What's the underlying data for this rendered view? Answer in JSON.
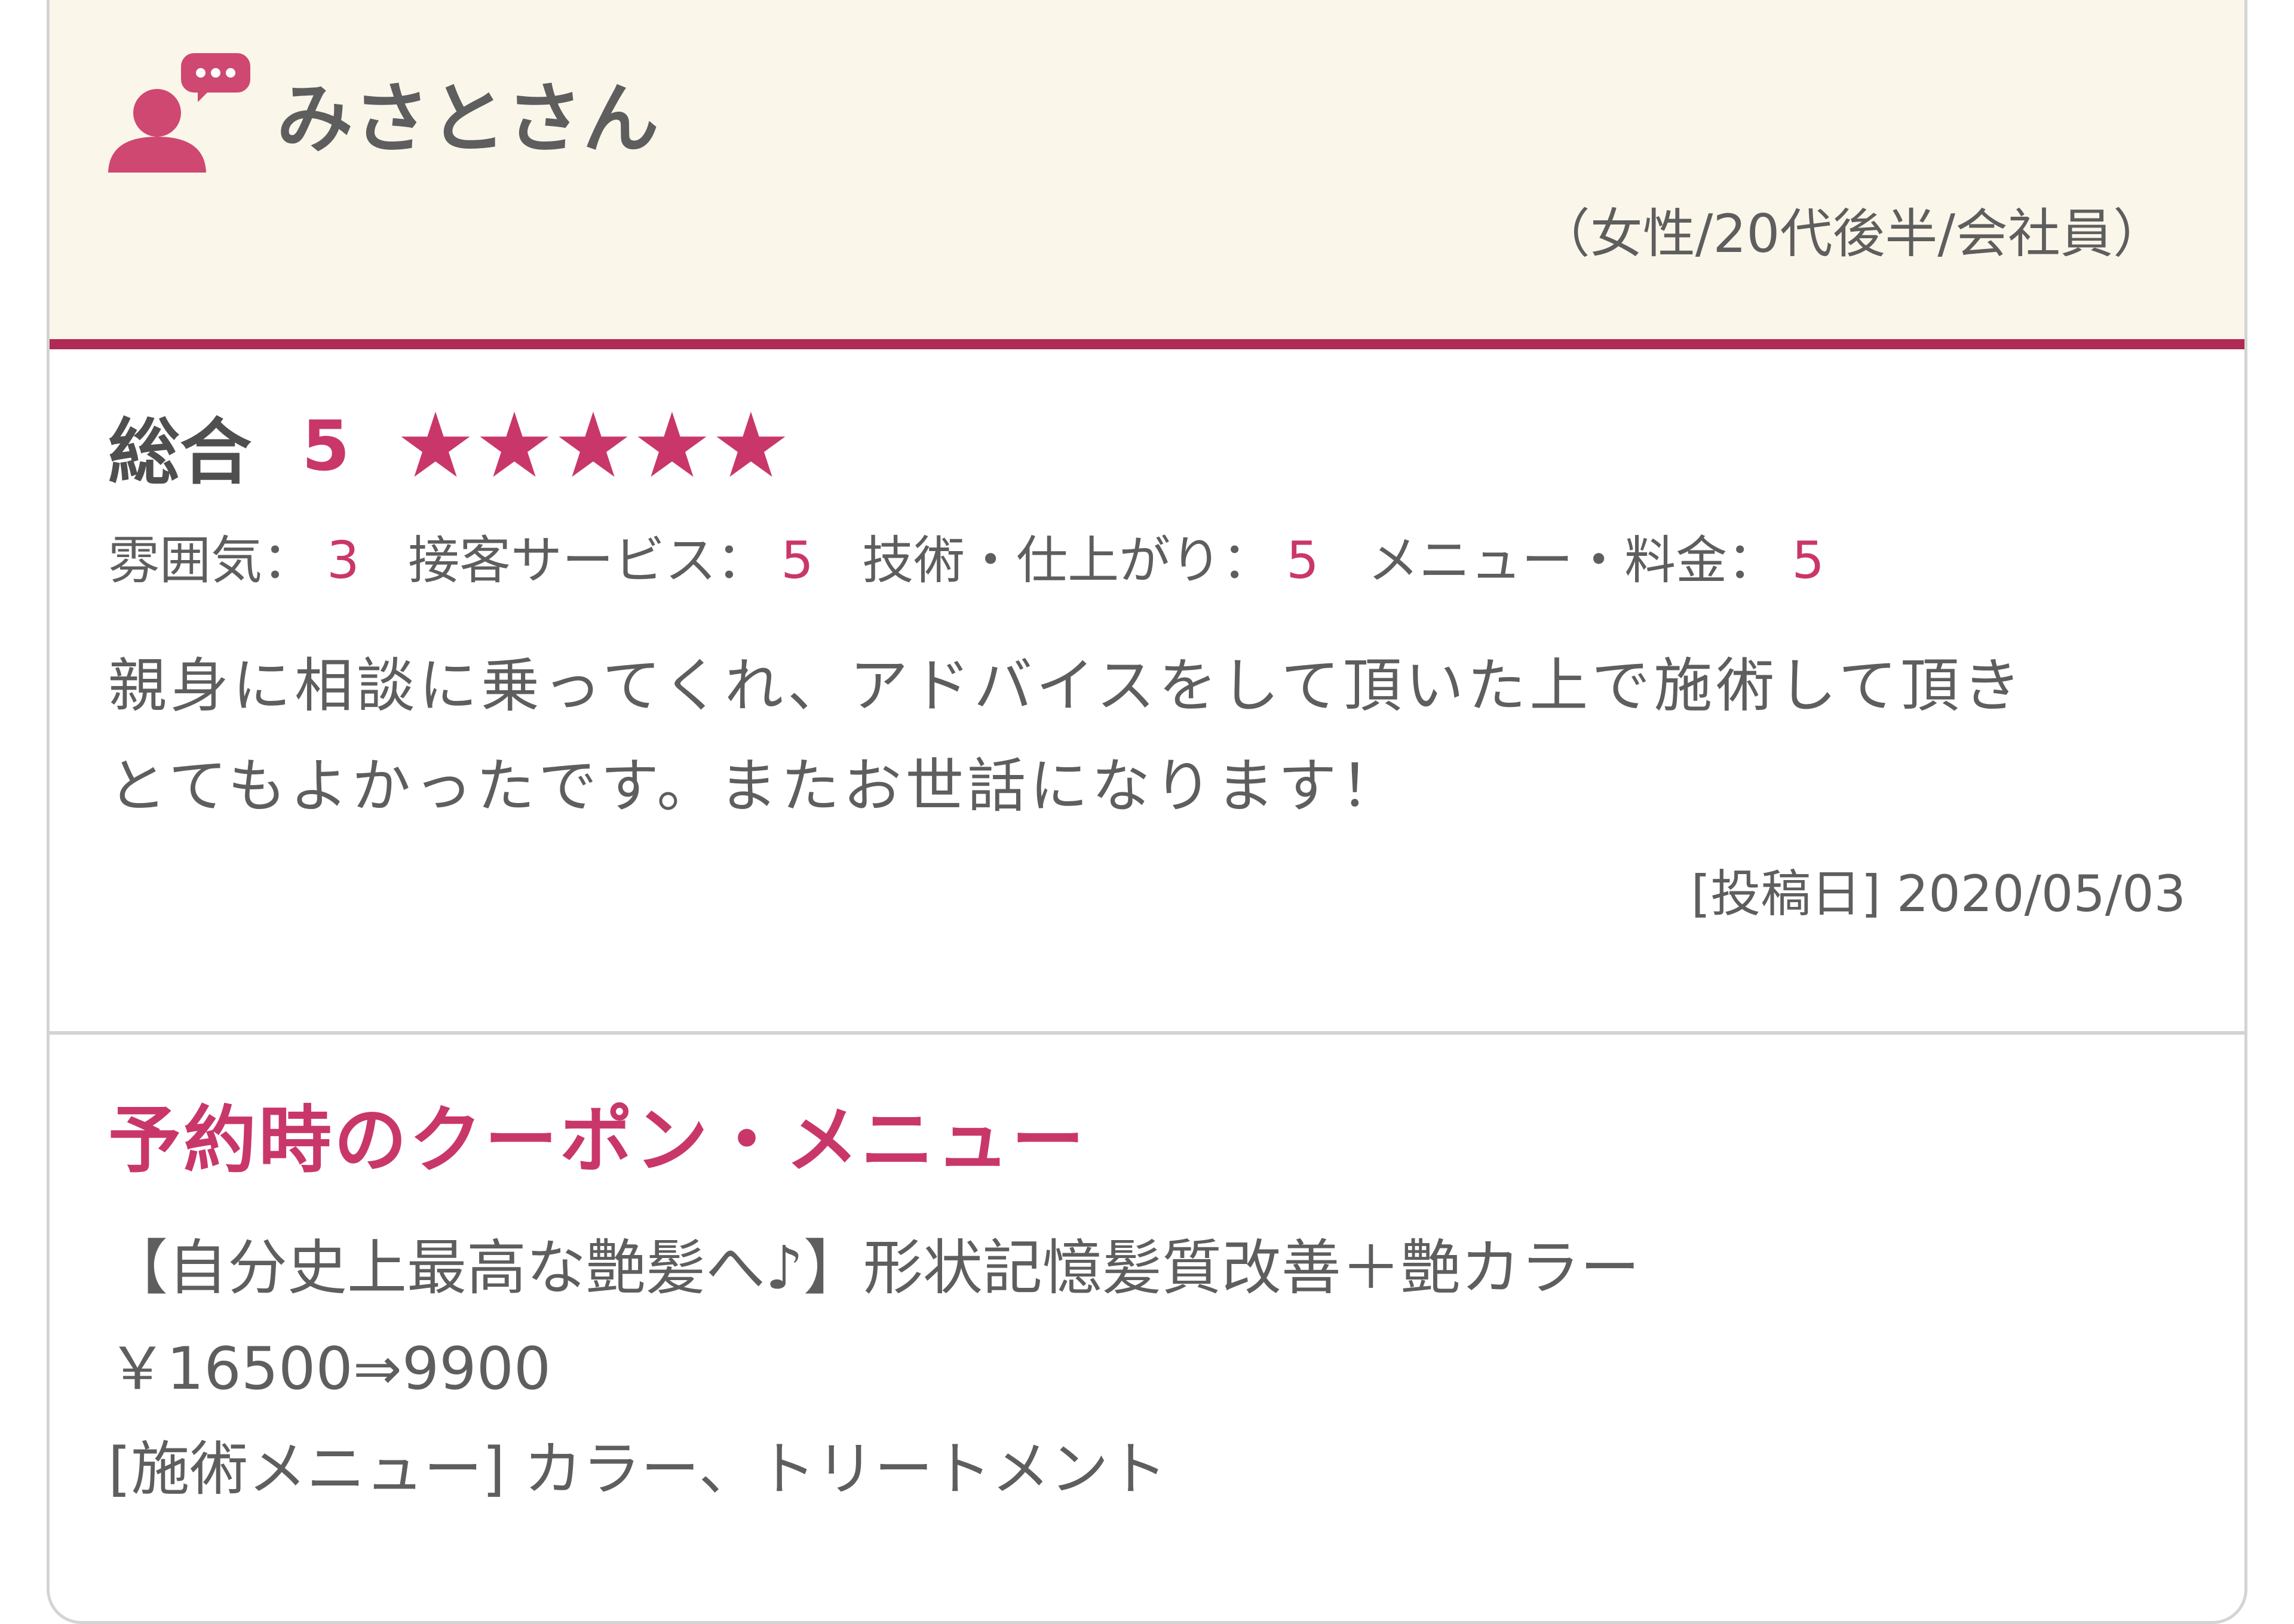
{
  "reviewer": {
    "name": "みさとさん",
    "profile": "（女性/20代後半/会社員）",
    "avatar_icon": "user-comment-icon"
  },
  "rating": {
    "overall_label": "総合",
    "overall_score": "5",
    "stars": 5,
    "subscores": [
      {
        "label": "雰囲気：",
        "value": "3"
      },
      {
        "label": "接客サービス：",
        "value": "5"
      },
      {
        "label": "技術・仕上がり：",
        "value": "5"
      },
      {
        "label": "メニュー・料金：",
        "value": "5"
      }
    ]
  },
  "review": {
    "text_line1": "親身に相談に乗ってくれ、アドバイスをして頂いた上で施術して頂き",
    "text_line2": "とてもよかったです。またお世話になります！",
    "post_date": "[投稿日] 2020/05/03"
  },
  "coupon": {
    "title": "予約時のクーポン・メニュー",
    "name": "【自分史上最高な艶髪へ♪】形状記憶髪質改善＋艶カラー",
    "price": "￥16500⇒9900",
    "menu": "[施術メニュー] カラー、トリートメント"
  },
  "colors": {
    "accent": "#c9376a",
    "header_bg": "#fbf6ea",
    "header_border": "#b02a56",
    "text": "#5e5e5e",
    "card_border": "#d4d4d4"
  }
}
